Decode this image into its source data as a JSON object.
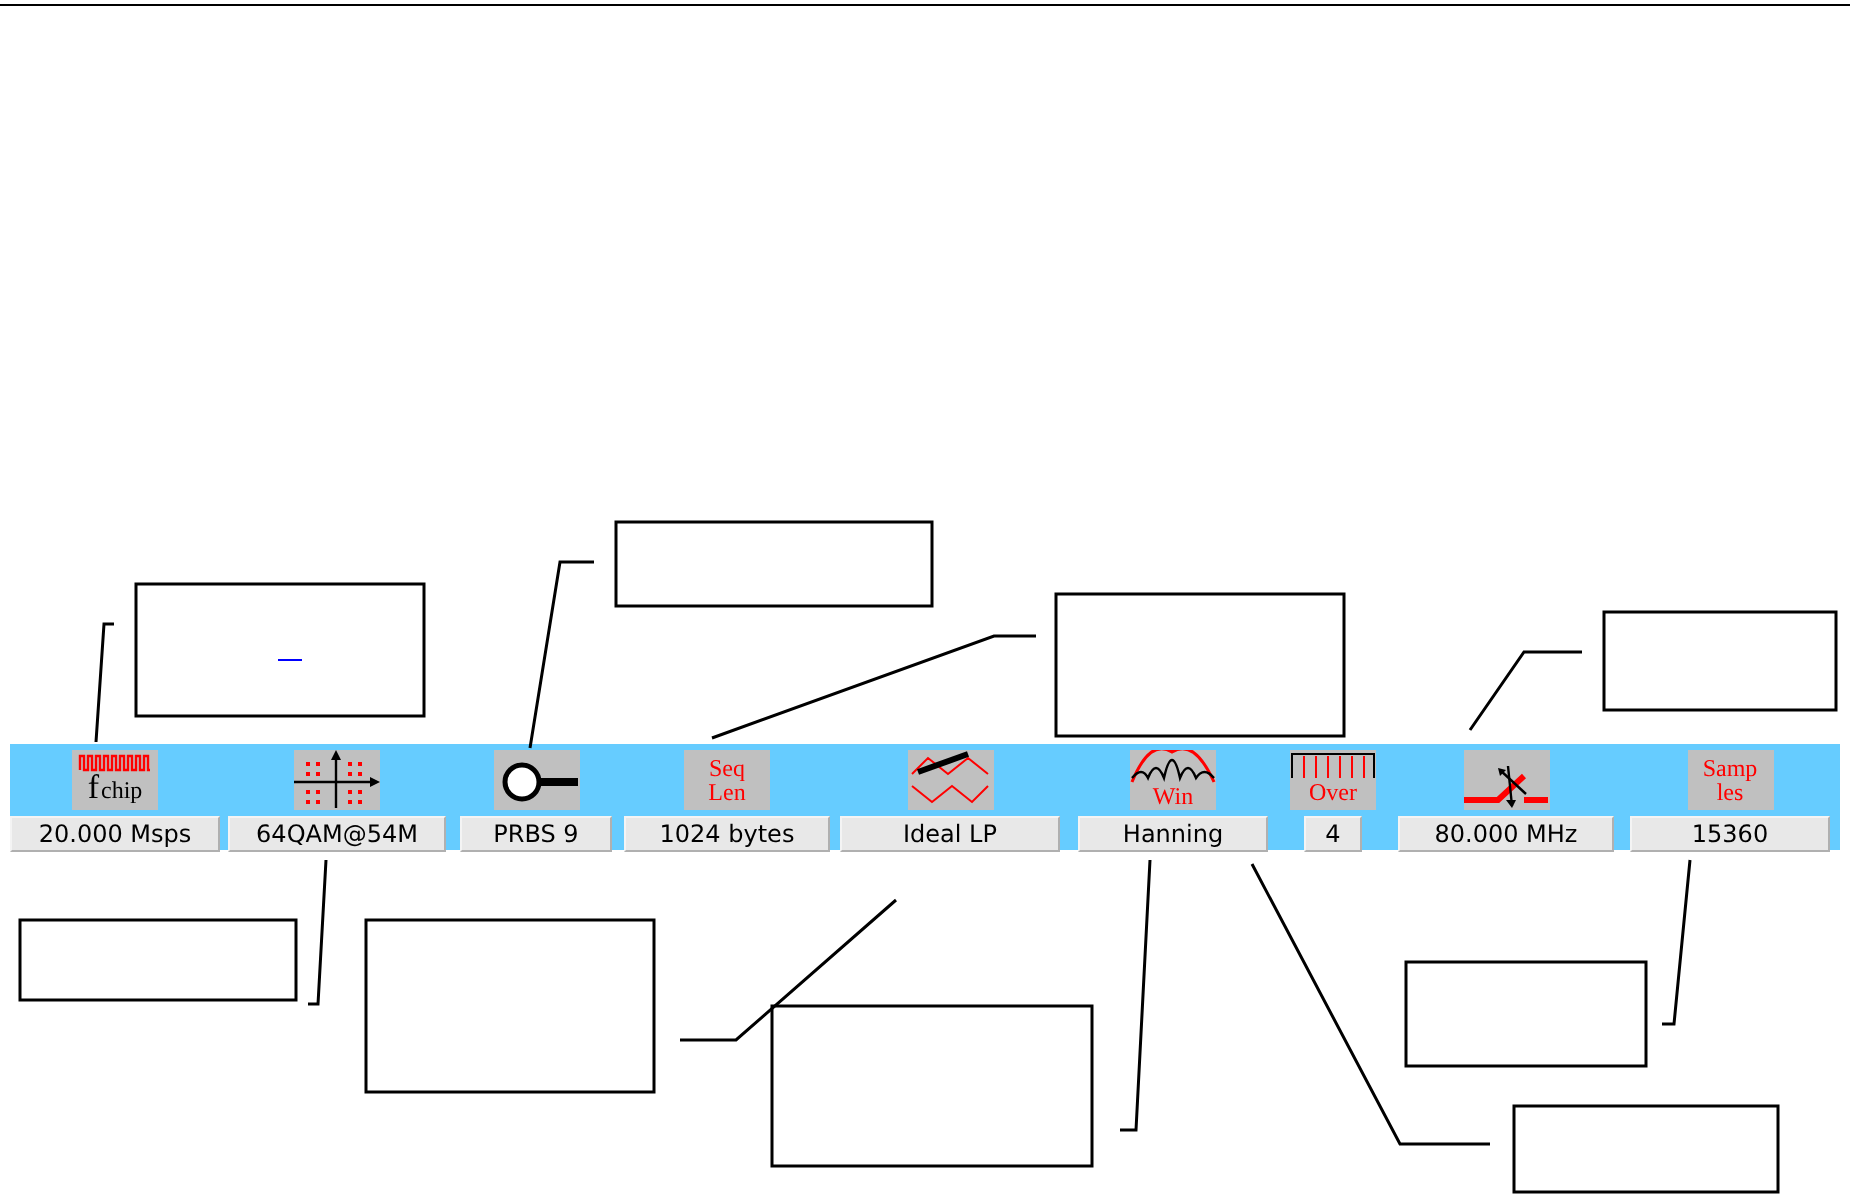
{
  "toolbar": {
    "items": [
      {
        "kind": "chip",
        "icon_text": [
          "f",
          "chip"
        ],
        "value": "20.000 Msps"
      },
      {
        "kind": "constellation",
        "value": "64QAM@54M"
      },
      {
        "kind": "probe",
        "value": "PRBS 9"
      },
      {
        "kind": "text",
        "icon_text": [
          "Seq",
          "Len"
        ],
        "value": "1024 bytes"
      },
      {
        "kind": "filter",
        "value": "Ideal LP"
      },
      {
        "kind": "window",
        "icon_text": [
          "Win"
        ],
        "value": "Hanning"
      },
      {
        "kind": "oversample",
        "icon_text": [
          "Over"
        ],
        "value": "4"
      },
      {
        "kind": "synth",
        "value": "80.000 MHz"
      },
      {
        "kind": "text",
        "icon_text": [
          "Samp",
          "les"
        ],
        "value": "15360"
      }
    ]
  }
}
